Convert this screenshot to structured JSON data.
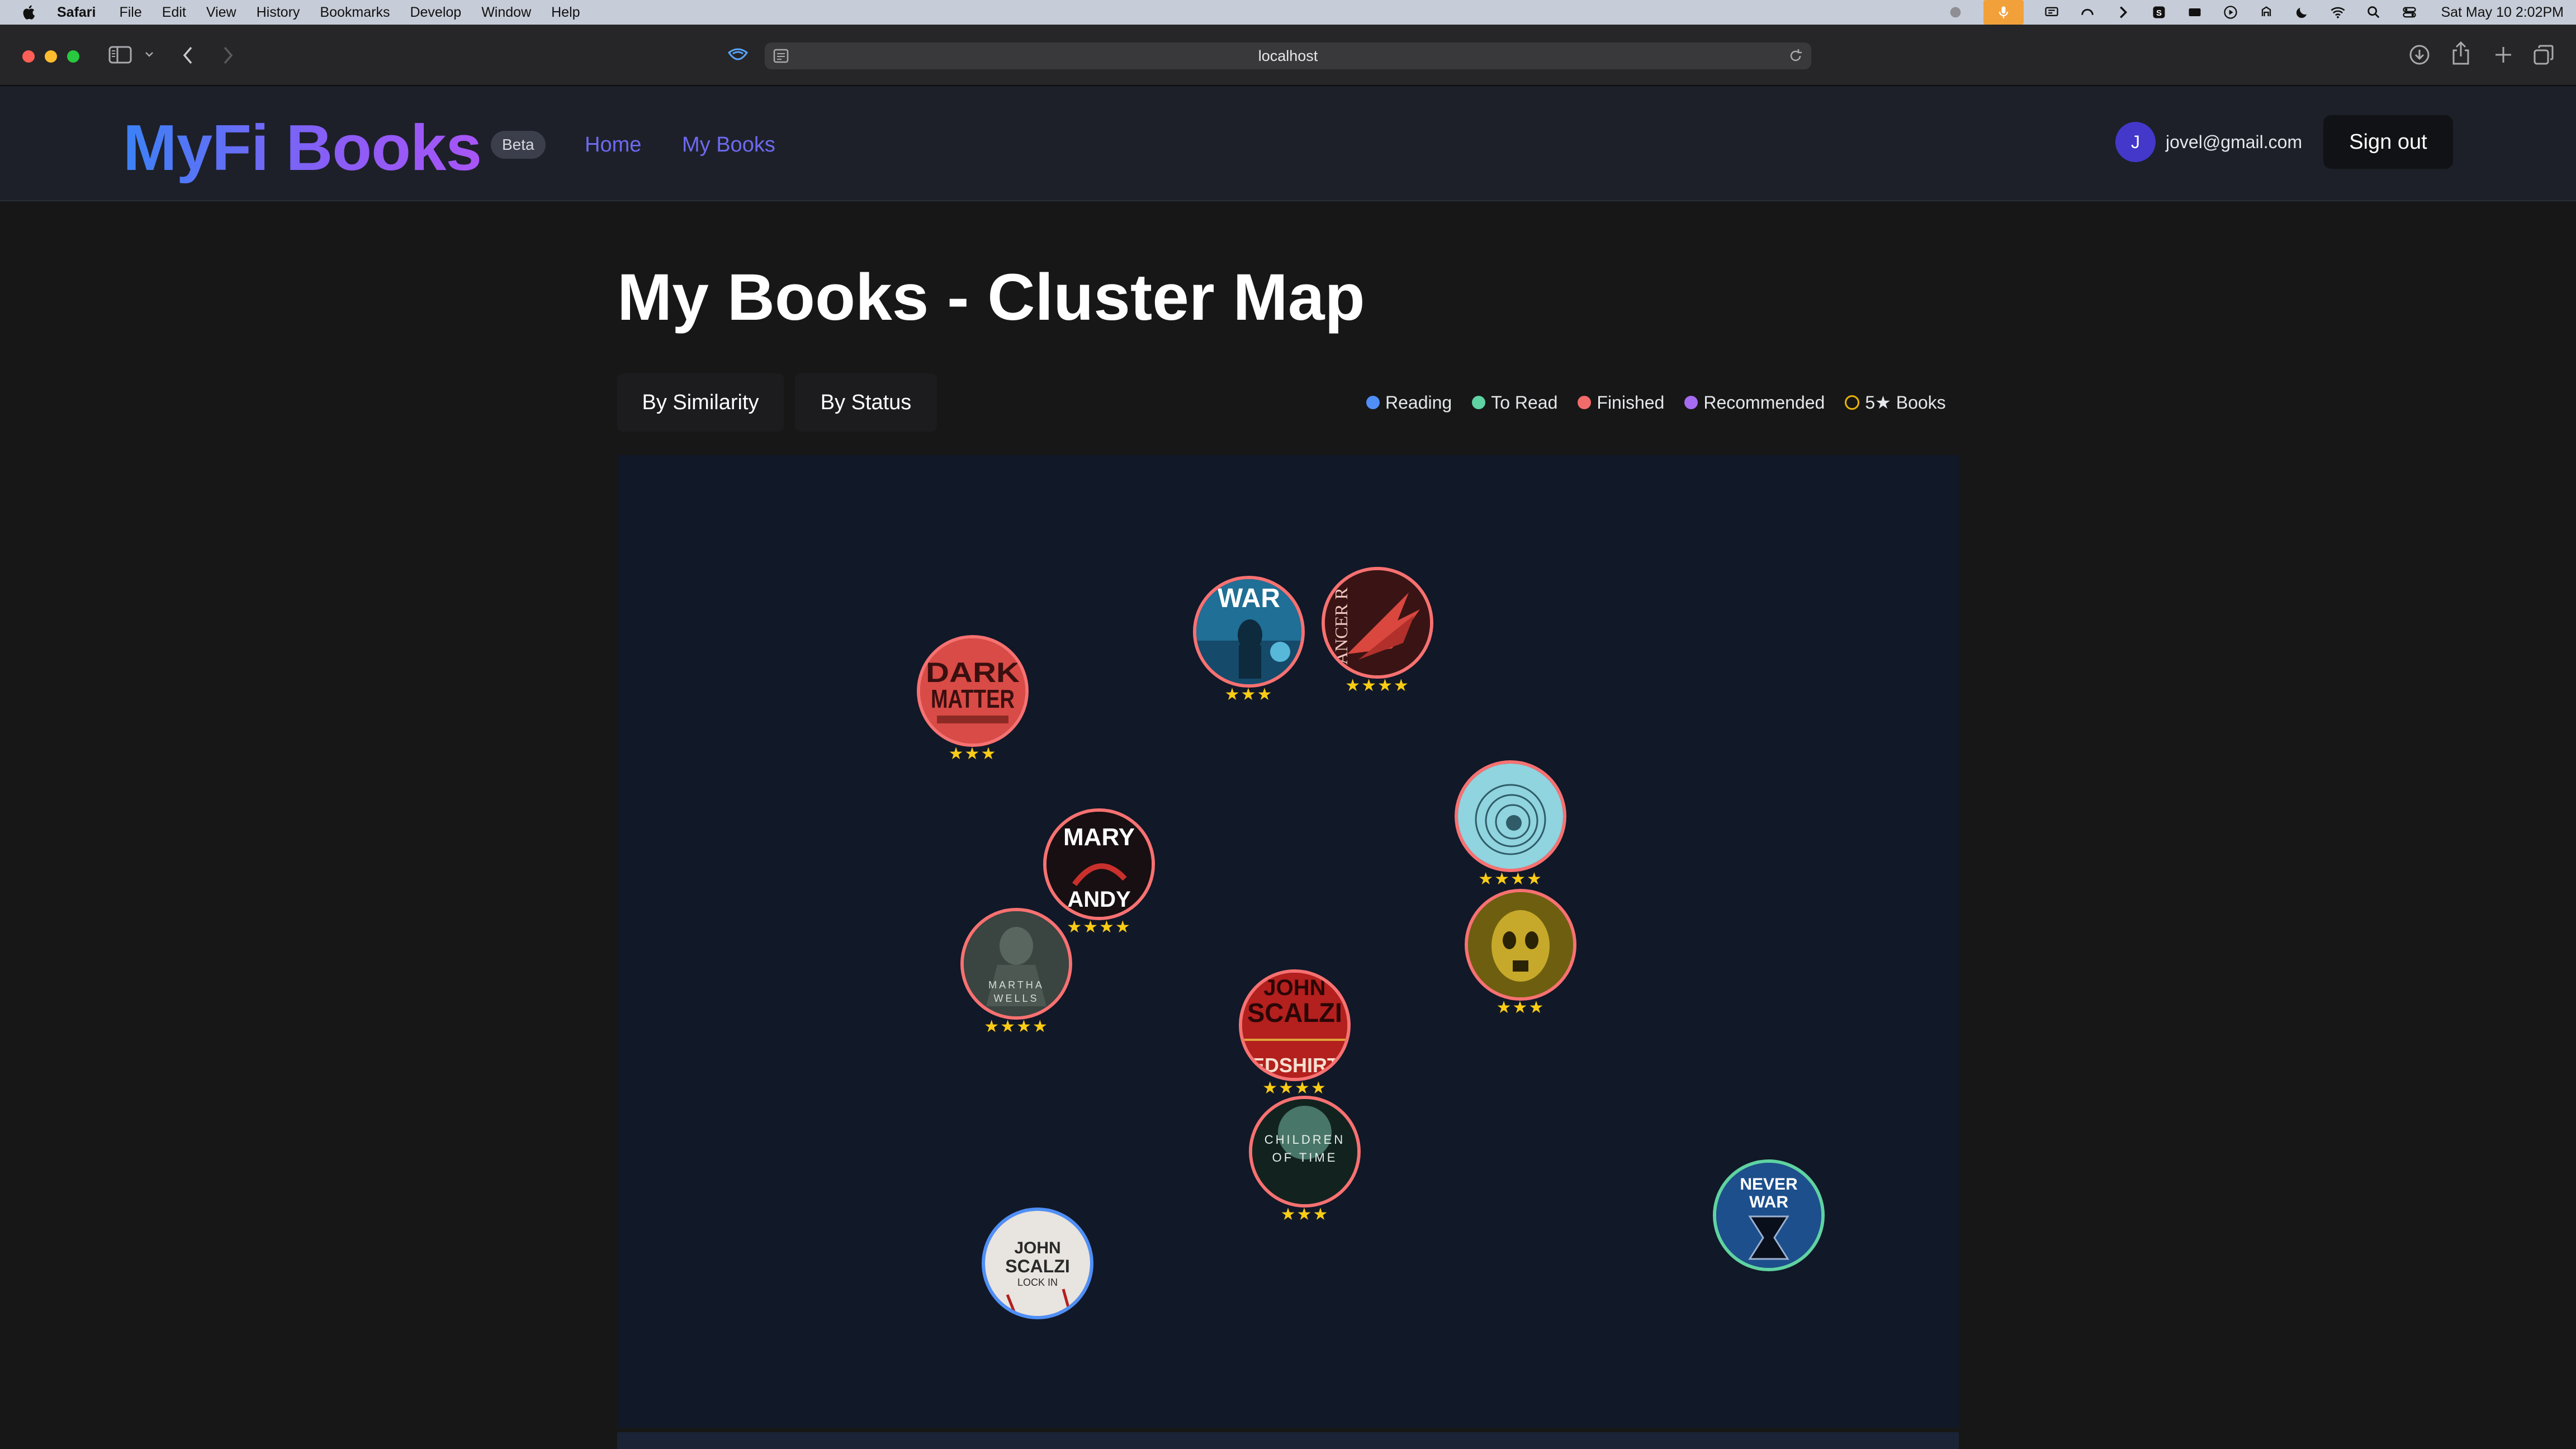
{
  "menubar": {
    "app": "Safari",
    "items": [
      "File",
      "Edit",
      "View",
      "History",
      "Bookmarks",
      "Develop",
      "Window",
      "Help"
    ],
    "clock": "Sat May 10  2:02PM"
  },
  "browser": {
    "url": "localhost"
  },
  "header": {
    "logo": "MyFi Books",
    "badge": "Beta",
    "nav": [
      "Home",
      "My Books"
    ],
    "avatar_initial": "J",
    "email": "jovel@gmail.com",
    "signout_label": "Sign out"
  },
  "page": {
    "title": "My Books - Cluster Map",
    "views": [
      "By Similarity",
      "By Status"
    ],
    "legend": [
      {
        "label": "Reading",
        "color": "#4f8ff7"
      },
      {
        "label": "To Read",
        "color": "#5fd3a2"
      },
      {
        "label": "Finished",
        "color": "#f26b6b"
      },
      {
        "label": "Recommended",
        "color": "#a56cf1"
      },
      {
        "label": "5★ Books",
        "color": "#eab308"
      }
    ]
  },
  "books": [
    {
      "id": "dark-matter",
      "cover_text": "DARK MATTER",
      "status": "finished",
      "stars": "★★★"
    },
    {
      "id": "war-book",
      "cover_text": "WAR",
      "status": "finished",
      "stars": "★★★"
    },
    {
      "id": "dancer-wings",
      "cover_text": "ANCER R",
      "status": "finished",
      "stars": "★★★★"
    },
    {
      "id": "spiral-book",
      "cover_text": "",
      "status": "finished",
      "stars": "★★★★"
    },
    {
      "id": "mary-andy",
      "cover_text": "MARY ANDY",
      "status": "finished",
      "stars": "★★★★"
    },
    {
      "id": "golden-mask",
      "cover_text": "",
      "status": "finished",
      "stars": "★★★"
    },
    {
      "id": "martha-wells",
      "cover_text": "MARTHA WELLS",
      "status": "finished",
      "stars": "★★★★"
    },
    {
      "id": "redshirts",
      "cover_text": "JOHN SCALZI REDSHIRTS",
      "status": "finished",
      "stars": "★★★★"
    },
    {
      "id": "children-of-time",
      "cover_text": "CHILDREN OF TIME",
      "status": "finished",
      "stars": "★★★"
    },
    {
      "id": "lock-in",
      "cover_text": "JOHN SCALZI LOCK IN",
      "status": "reading",
      "stars": ""
    },
    {
      "id": "never-war",
      "cover_text": "NEVER WAR",
      "status": "to-read",
      "stars": ""
    }
  ]
}
